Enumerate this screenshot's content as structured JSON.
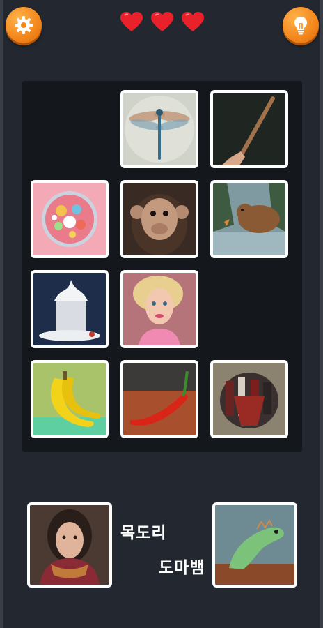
{
  "hud": {
    "settings_icon": "gear-icon",
    "hint_icon": "lightbulb-icon",
    "lives": 3,
    "heart_color": "#e8212a"
  },
  "board": {
    "tiles": [
      {
        "subject": "dragonfly"
      },
      {
        "subject": "stick"
      },
      {
        "subject": "candy"
      },
      {
        "subject": "monkey"
      },
      {
        "subject": "beaver"
      },
      {
        "subject": "milk"
      },
      {
        "subject": "doll"
      },
      {
        "subject": "banana"
      },
      {
        "subject": "chili-pepper"
      },
      {
        "subject": "crowd"
      }
    ]
  },
  "bottom": {
    "left_card": {
      "subject": "woman-with-scarf"
    },
    "right_card": {
      "subject": "iguana"
    },
    "word1": "목도리",
    "word2": "도마뱀"
  },
  "colors": {
    "background": "#232830",
    "board": "#14181d",
    "accent": "#f3861b"
  }
}
